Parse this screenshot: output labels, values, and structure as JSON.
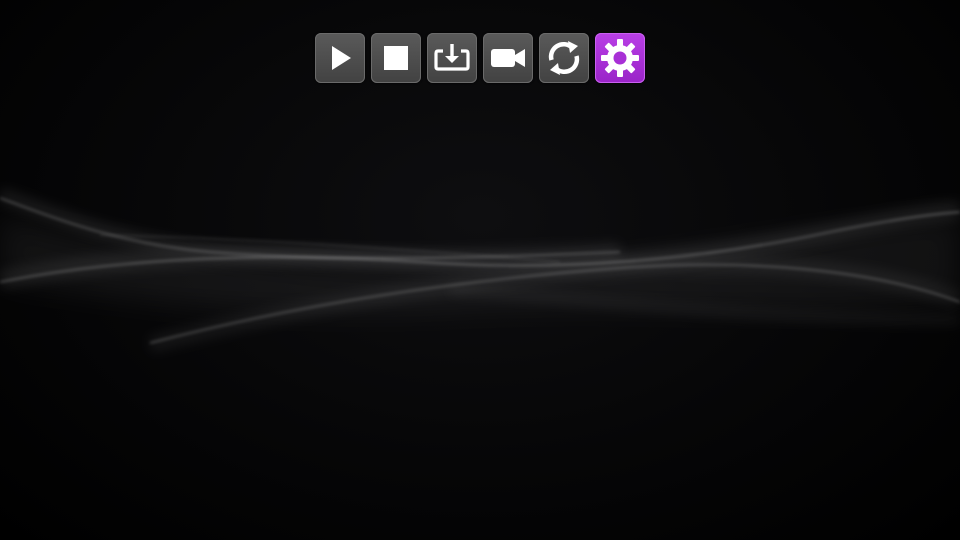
{
  "toolbar": {
    "buttons": [
      {
        "id": "play",
        "icon": "play-icon",
        "tooltip": ""
      },
      {
        "id": "stop",
        "icon": "stop-icon",
        "tooltip": ""
      },
      {
        "id": "save",
        "icon": "download-tray-icon",
        "tooltip": ""
      },
      {
        "id": "record",
        "icon": "video-camera-icon",
        "tooltip": ""
      },
      {
        "id": "refresh",
        "icon": "refresh-icon",
        "tooltip": ""
      },
      {
        "id": "settings",
        "icon": "gear-icon",
        "tooltip": ""
      }
    ],
    "active_button": "settings",
    "colors": {
      "button_bg": "#4b4b4b",
      "icon": "#ffffff",
      "active_bg": "#a830d6"
    }
  },
  "wallpaper": {
    "style": "dark-waves",
    "background": "#000000",
    "wave_color": "#ffffff"
  }
}
